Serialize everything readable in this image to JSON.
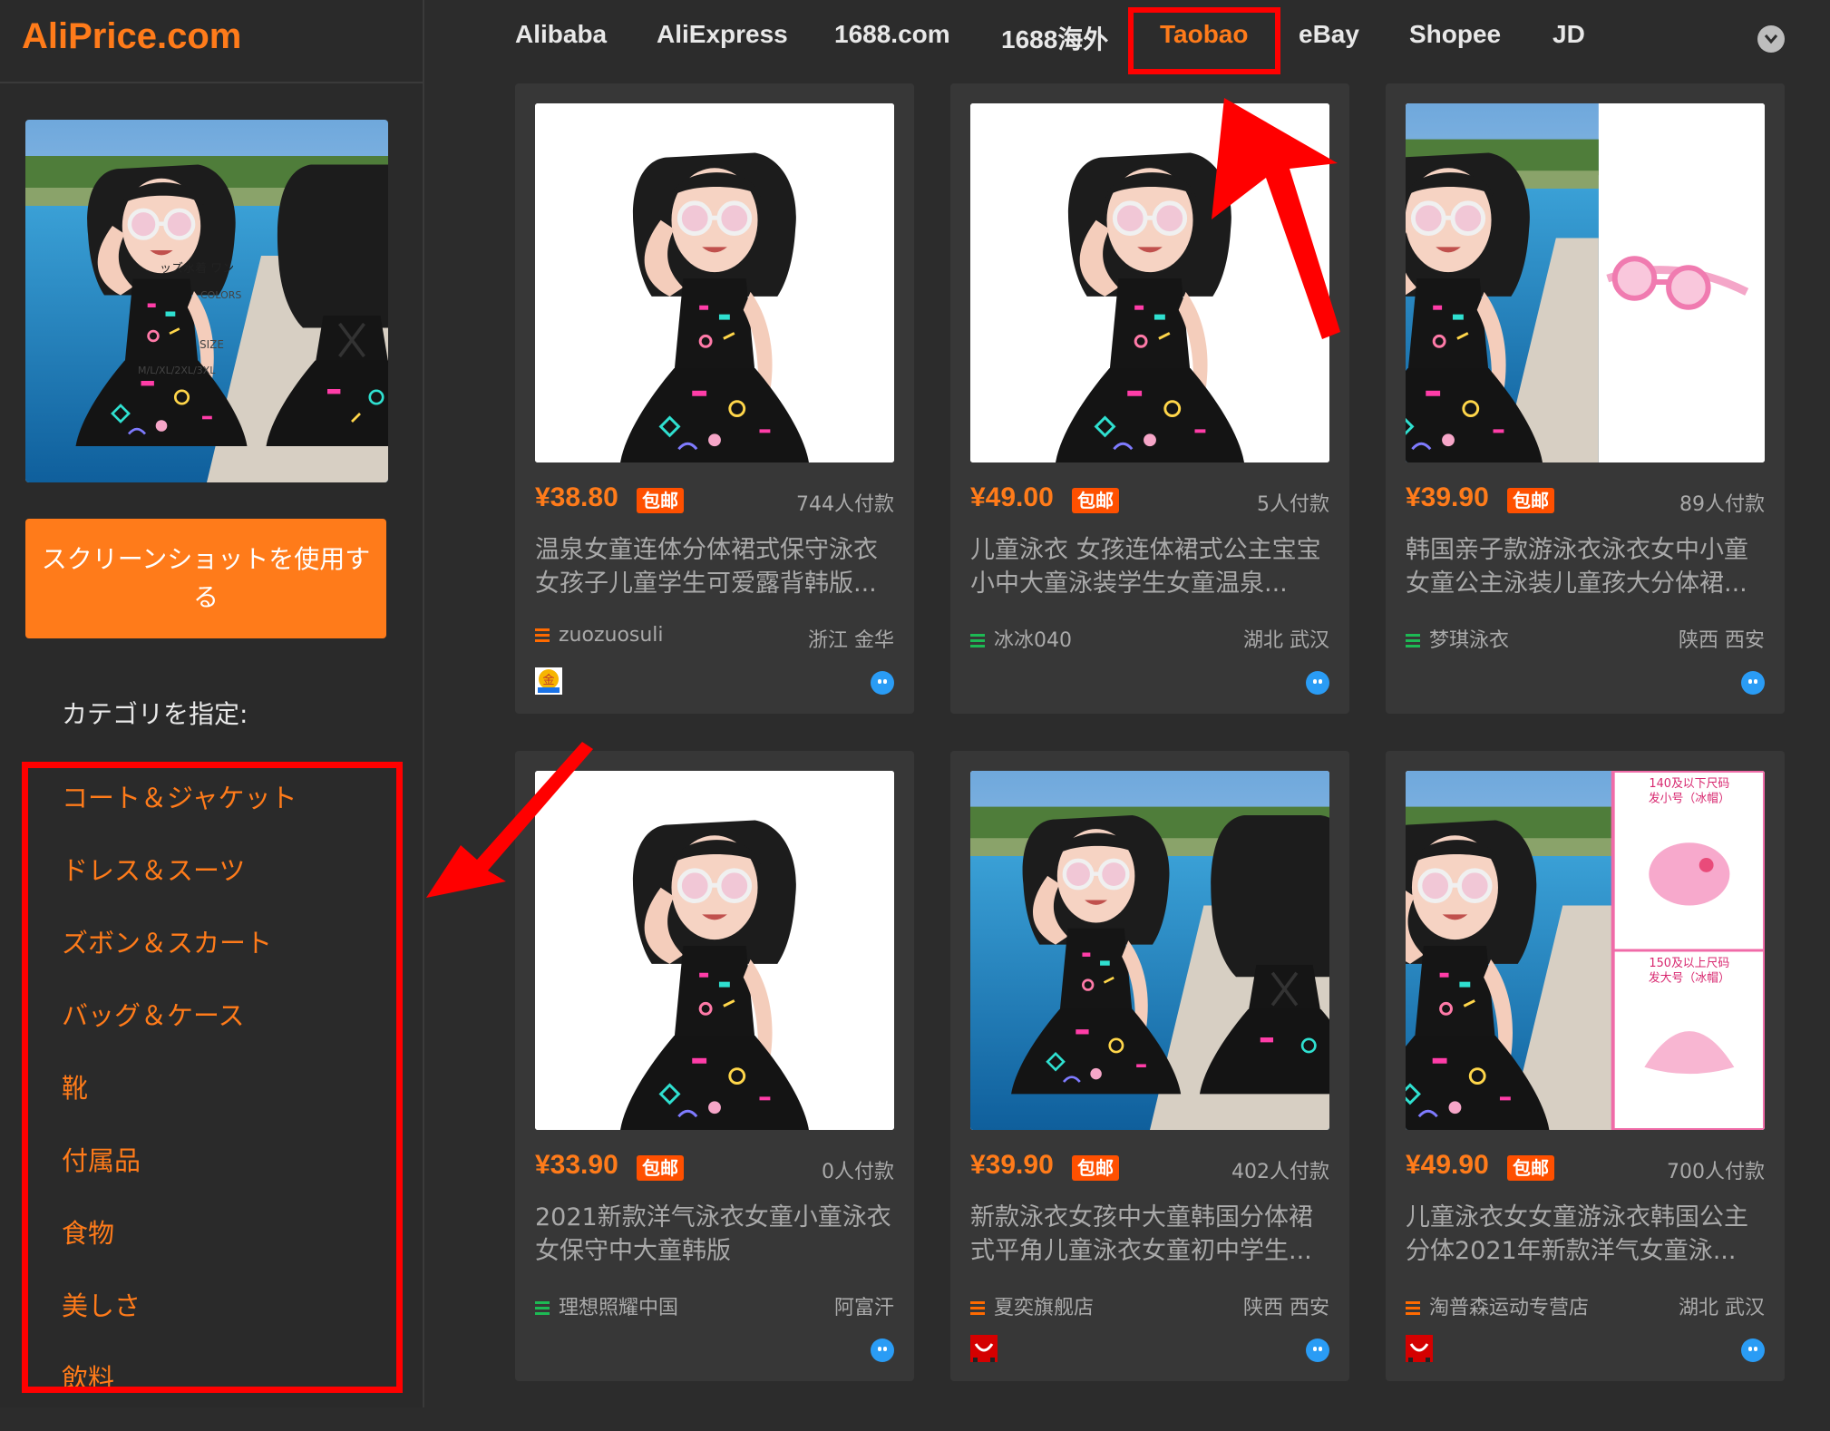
{
  "sidebar": {
    "logo": "AliPrice.com",
    "screenshot_button": "スクリーンショットを使用する",
    "category_title": "カテゴリを指定:",
    "categories": [
      "コート＆ジャケット",
      "ドレス＆スーツ",
      "ズボン＆スカート",
      "バッグ＆ケース",
      "靴",
      "付属品",
      "食物",
      "美しさ",
      "飲料"
    ]
  },
  "tabs": [
    "Alibaba",
    "AliExpress",
    "1688.com",
    "1688海外",
    "Taobao",
    "eBay",
    "Shopee",
    "JD"
  ],
  "active_tab": "Taobao",
  "colors": {
    "accent": "#ff7b1a",
    "highlight": "#ff0000",
    "background": "#2c2c2c",
    "card": "#373737"
  },
  "products": [
    {
      "price": "¥38.80",
      "badge": "包邮",
      "paid": "744人付款",
      "title": "温泉女童连体分体裙式保守泳衣女孩子儿童学生可爱露背韩版...",
      "seller": "zuozuosuli",
      "seller_icon": "orange-menu-icon",
      "location": "浙江 金华",
      "foot_icon": "gold-medal-icon"
    },
    {
      "price": "¥49.00",
      "badge": "包邮",
      "paid": "5人付款",
      "title": "儿童泳衣 女孩连体裙式公主宝宝小中大童泳装学生女童温泉...",
      "seller": "冰冰040",
      "seller_icon": "green-menu-icon",
      "location": "湖北 武汉",
      "foot_icon": ""
    },
    {
      "price": "¥39.90",
      "badge": "包邮",
      "paid": "89人付款",
      "title": "韩国亲子款游泳衣泳衣女中小童女童公主泳装儿童孩大分体裙...",
      "seller": "梦琪泳衣",
      "seller_icon": "green-menu-icon",
      "location": "陕西 西安",
      "foot_icon": ""
    },
    {
      "price": "¥33.90",
      "badge": "包邮",
      "paid": "0人付款",
      "title": "2021新款洋气泳衣女童小童泳衣女保守中大童韩版",
      "seller": "理想照耀中国",
      "seller_icon": "green-menu-icon",
      "location": "阿富汗",
      "foot_icon": ""
    },
    {
      "price": "¥39.90",
      "badge": "包邮",
      "paid": "402人付款",
      "title": "新款泳衣女孩中大童韩国分体裙式平角儿童泳衣女童初中学生...",
      "seller": "夏奕旗舰店",
      "seller_icon": "orange-menu-icon",
      "location": "陕西 西安",
      "foot_icon": "tmall-icon"
    },
    {
      "price": "¥49.90",
      "badge": "包邮",
      "paid": "700人付款",
      "title": "儿童泳衣女女童游泳衣韩国公主分体2021年新款洋气女童泳...",
      "seller": "淘普森运动专营店",
      "seller_icon": "orange-menu-icon",
      "location": "湖北 武汉",
      "foot_icon": "tmall-icon"
    }
  ],
  "cap_labels": {
    "small": "140及以下尺码\n发小号（冰帽）",
    "large": "150及以上尺码\n发大号（冰帽）"
  },
  "query_overlay": {
    "line1": "ッズ水着 ワン",
    "colors": "COLORS",
    "size": "SIZE",
    "sizes": "M/L/XL/2XL/3XL"
  }
}
